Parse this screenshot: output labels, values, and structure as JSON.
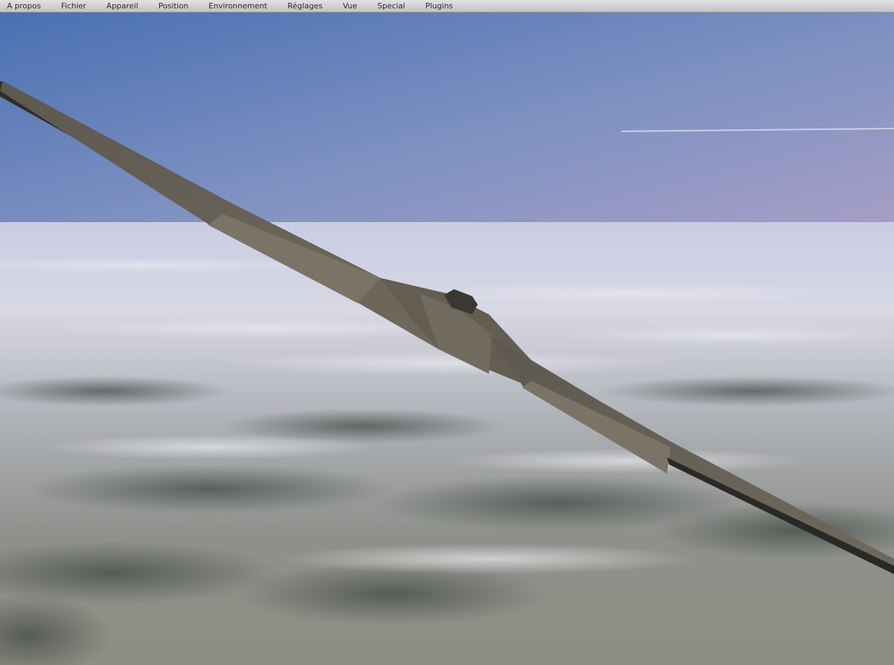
{
  "menubar": {
    "items": [
      {
        "label": "A propos"
      },
      {
        "label": "Fichier"
      },
      {
        "label": "Appareil"
      },
      {
        "label": "Position"
      },
      {
        "label": "Environnement"
      },
      {
        "label": "Réglages"
      },
      {
        "label": "Vue"
      },
      {
        "label": "Special"
      },
      {
        "label": "Plugins"
      }
    ]
  },
  "scene": {
    "sky_top": "#4f74b4",
    "sky_horizon": "#a39dc4",
    "cloud_color": "#d9dae6",
    "ground_color": "#6f7268",
    "aircraft_color": "#6b6559",
    "aircraft_shadow": "#2e2c28"
  }
}
